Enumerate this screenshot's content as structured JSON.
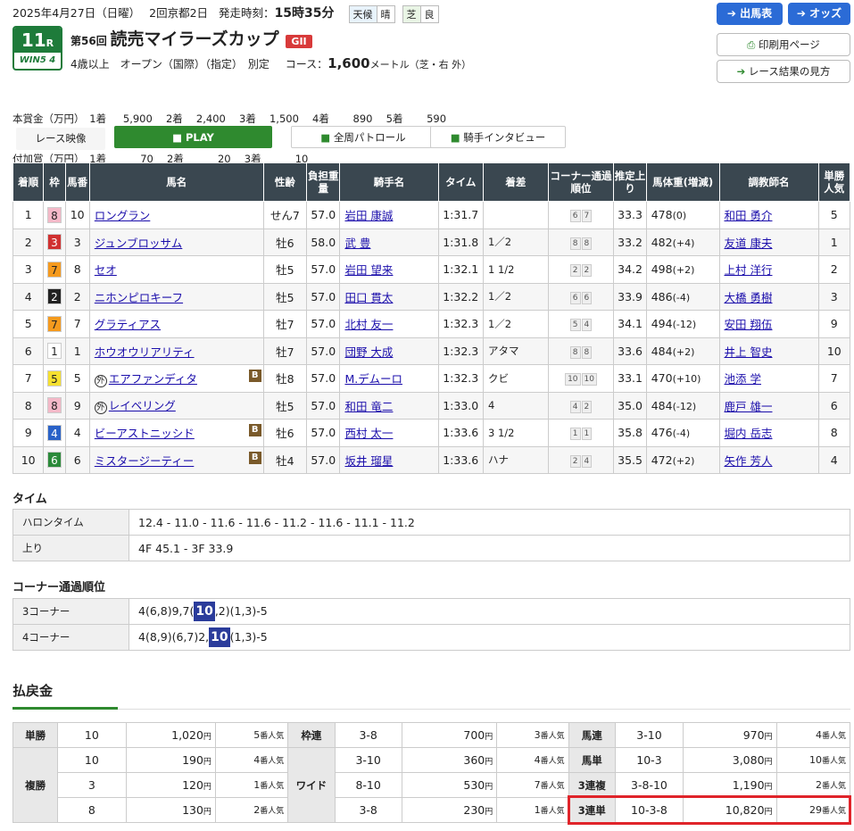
{
  "header": {
    "date": "2025年4月27日（日曜）",
    "kai": "2回京都2日",
    "post_label": "発走時刻：",
    "post_time": "15時35分",
    "weather_label": "天候",
    "weather": "晴",
    "track_label": "芝",
    "track_cond": "良"
  },
  "buttons": {
    "entries": "出馬表",
    "odds": "オッズ",
    "print": "印刷用ページ",
    "howto": "レース結果の見方"
  },
  "race": {
    "round": "11",
    "round_unit": "R",
    "win5": "WIN5",
    "win5_num": "4",
    "nth": "第56回",
    "name": "読売マイラーズカップ",
    "grade": "GII",
    "conditions": "4歳以上　オープン（国際）（指定）　別定",
    "course_label": "コース：",
    "distance": "1,600",
    "course_unit": "メートル（芝・右 外）"
  },
  "prize": {
    "line1": "本賞金（万円）　1着　  5,900　 2着　 2,400　 3着　 1,500　 4着　　 890　 5着　　 590",
    "line2": "付加賞（万円）　1着　　　 70　 2着　　　 20　 3着　　　 10"
  },
  "video": {
    "label": "レース映像",
    "play": "PLAY",
    "patrol": "全周パトロール",
    "interview": "騎手インタビュー"
  },
  "result_headers": [
    "着順",
    "枠",
    "馬番",
    "馬名",
    "性齢",
    "負担重量",
    "騎手名",
    "タイム",
    "着差",
    "コーナー通過順位",
    "推定上り",
    "馬体重(増減)",
    "調教師名",
    "単勝人気"
  ],
  "results": [
    {
      "rank": "1",
      "waku": "8",
      "num": "10",
      "horse": "ロングラン",
      "mark": "",
      "b": false,
      "sex": "せん7",
      "wt": "57.0",
      "jockey": "岩田 康誠",
      "time": "1:31.7",
      "margin": "",
      "c1": "6",
      "c2": "7",
      "last": "33.3",
      "bw": "478",
      "bwd": "(0)",
      "trainer": "和田 勇介",
      "pop": "5"
    },
    {
      "rank": "2",
      "waku": "3",
      "num": "3",
      "horse": "ジュンブロッサム",
      "mark": "",
      "b": false,
      "sex": "牡6",
      "wt": "58.0",
      "jockey": "武 豊",
      "time": "1:31.8",
      "margin": "1／2",
      "c1": "8",
      "c2": "8",
      "last": "33.2",
      "bw": "482",
      "bwd": "(+4)",
      "trainer": "友道 康夫",
      "pop": "1"
    },
    {
      "rank": "3",
      "waku": "7",
      "num": "8",
      "horse": "セオ",
      "mark": "",
      "b": false,
      "sex": "牡5",
      "wt": "57.0",
      "jockey": "岩田 望来",
      "time": "1:32.1",
      "margin": "1 1/2",
      "c1": "2",
      "c2": "2",
      "last": "34.2",
      "bw": "498",
      "bwd": "(+2)",
      "trainer": "上村 洋行",
      "pop": "2"
    },
    {
      "rank": "4",
      "waku": "2",
      "num": "2",
      "horse": "ニホンピロキーフ",
      "mark": "",
      "b": false,
      "sex": "牡5",
      "wt": "57.0",
      "jockey": "田口 貫太",
      "time": "1:32.2",
      "margin": "1／2",
      "c1": "6",
      "c2": "6",
      "last": "33.9",
      "bw": "486",
      "bwd": "(-4)",
      "trainer": "大橋 勇樹",
      "pop": "3"
    },
    {
      "rank": "5",
      "waku": "7",
      "num": "7",
      "horse": "グラティアス",
      "mark": "",
      "b": false,
      "sex": "牡7",
      "wt": "57.0",
      "jockey": "北村 友一",
      "time": "1:32.3",
      "margin": "1／2",
      "c1": "5",
      "c2": "4",
      "last": "34.1",
      "bw": "494",
      "bwd": "(-12)",
      "trainer": "安田 翔伍",
      "pop": "9"
    },
    {
      "rank": "6",
      "waku": "1",
      "num": "1",
      "horse": "ホウオウリアリティ",
      "mark": "",
      "b": false,
      "sex": "牡7",
      "wt": "57.0",
      "jockey": "団野 大成",
      "time": "1:32.3",
      "margin": "アタマ",
      "c1": "8",
      "c2": "8",
      "last": "33.6",
      "bw": "484",
      "bwd": "(+2)",
      "trainer": "井上 智史",
      "pop": "10"
    },
    {
      "rank": "7",
      "waku": "5",
      "num": "5",
      "horse": "エアファンディタ",
      "mark": "外",
      "b": true,
      "sex": "牡8",
      "wt": "57.0",
      "jockey": "M.デムーロ",
      "time": "1:32.3",
      "margin": "クビ",
      "c1": "10",
      "c2": "10",
      "last": "33.1",
      "bw": "470",
      "bwd": "(+10)",
      "trainer": "池添 学",
      "pop": "7"
    },
    {
      "rank": "8",
      "waku": "8",
      "num": "9",
      "horse": "レイベリング",
      "mark": "外",
      "b": false,
      "sex": "牡5",
      "wt": "57.0",
      "jockey": "和田 竜二",
      "time": "1:33.0",
      "margin": "4",
      "c1": "4",
      "c2": "2",
      "last": "35.0",
      "bw": "484",
      "bwd": "(-12)",
      "trainer": "鹿戸 雄一",
      "pop": "6"
    },
    {
      "rank": "9",
      "waku": "4",
      "num": "4",
      "horse": "ビーアストニッシド",
      "mark": "",
      "b": true,
      "sex": "牡6",
      "wt": "57.0",
      "jockey": "西村 太一",
      "time": "1:33.6",
      "margin": "3 1/2",
      "c1": "1",
      "c2": "1",
      "last": "35.8",
      "bw": "476",
      "bwd": "(-4)",
      "trainer": "堀内 岳志",
      "pop": "8"
    },
    {
      "rank": "10",
      "waku": "6",
      "num": "6",
      "horse": "ミスタージーティー",
      "mark": "",
      "b": true,
      "sex": "牡4",
      "wt": "57.0",
      "jockey": "坂井 瑠星",
      "time": "1:33.6",
      "margin": "ハナ",
      "c1": "2",
      "c2": "4",
      "last": "35.5",
      "bw": "472",
      "bwd": "(+2)",
      "trainer": "矢作 芳人",
      "pop": "4"
    }
  ],
  "time_section": {
    "title": "タイム",
    "lap_label": "ハロンタイム",
    "laps": "12.4 - 11.0 - 11.6 - 11.6 - 11.2 - 11.6 - 11.1 - 11.2",
    "agari_label": "上り",
    "agari": "4F 45.1 - 3F 33.9"
  },
  "corner_section": {
    "title": "コーナー通過順位",
    "c3_label": "3コーナー",
    "c3_pre": "4(6,8)9,7(",
    "c3_hl": "10",
    "c3_post": ",2)(1,3)-5",
    "c4_label": "4コーナー",
    "c4_pre": "4(8,9)(6,7)2,",
    "c4_hl": "10",
    "c4_post": "(1,3)-5"
  },
  "payout": {
    "title": "払戻金",
    "yen": "円",
    "pop_suffix": "番人気",
    "tansho": {
      "label": "単勝",
      "num": "10",
      "amt": "1,020",
      "pop": "5"
    },
    "fukusho": {
      "label": "複勝",
      "rows": [
        {
          "num": "10",
          "amt": "190",
          "pop": "4"
        },
        {
          "num": "3",
          "amt": "120",
          "pop": "1"
        },
        {
          "num": "8",
          "amt": "130",
          "pop": "2"
        }
      ]
    },
    "wakuren": {
      "label": "枠連",
      "num": "3-8",
      "amt": "700",
      "pop": "3"
    },
    "wide": {
      "label": "ワイド",
      "rows": [
        {
          "num": "3-10",
          "amt": "360",
          "pop": "4"
        },
        {
          "num": "8-10",
          "amt": "530",
          "pop": "7"
        },
        {
          "num": "3-8",
          "amt": "230",
          "pop": "1"
        }
      ]
    },
    "umaren": {
      "label": "馬連",
      "num": "3-10",
      "amt": "970",
      "pop": "4"
    },
    "umatan": {
      "label": "馬単",
      "num": "10-3",
      "amt": "3,080",
      "pop": "10"
    },
    "sanrenpuku": {
      "label": "3連複",
      "num": "3-8-10",
      "amt": "1,190",
      "pop": "2"
    },
    "sanrentan": {
      "label": "3連単",
      "num": "10-3-8",
      "amt": "10,820",
      "pop": "29"
    }
  },
  "colors": {
    "waku1": "#ffffff",
    "waku2": "#222222",
    "waku3": "#d03030",
    "waku4": "#2a62c8",
    "waku5": "#f5e030",
    "waku6": "#2b8a3a",
    "waku7": "#f59a1e",
    "waku8": "#f4b9c8",
    "highlight_border": "#e0242a"
  }
}
